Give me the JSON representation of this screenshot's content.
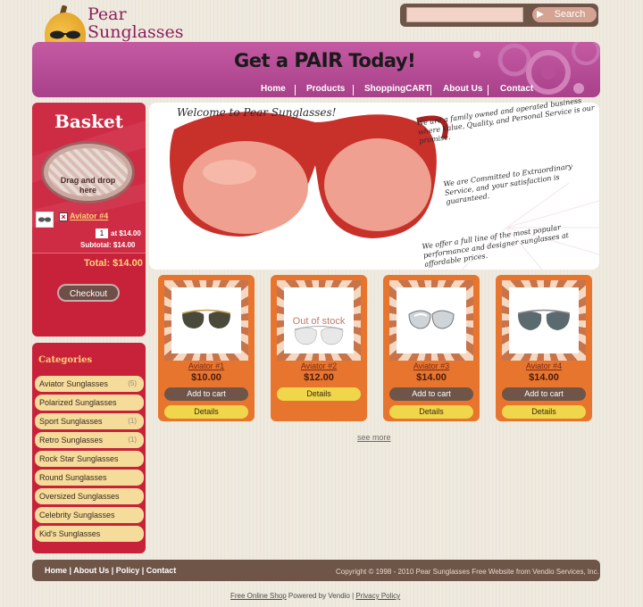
{
  "header": {
    "logo_line1": "Pear",
    "logo_line2": "Sunglasses",
    "search_placeholder": "",
    "search_button": "Search"
  },
  "banner": {
    "slogan_pre": "Get a",
    "slogan_big": "PAIR",
    "slogan_post": "Today!",
    "nav": [
      "Home",
      "Products",
      "ShoppingCART",
      "About Us",
      "Contact"
    ]
  },
  "basket": {
    "title": "Basket",
    "drop_text": "Drag and drop here",
    "item_name": "Aviator #4",
    "item_qty": "1",
    "item_price": "at $14.00",
    "subtotal": "Subtotal: $14.00",
    "total": "Total: $14.00",
    "checkout": "Checkout"
  },
  "categories": {
    "title": "Categories",
    "items": [
      {
        "label": "Aviator Sunglasses",
        "count": "(5)"
      },
      {
        "label": "Polarized Sunglasses",
        "count": ""
      },
      {
        "label": "Sport Sunglasses",
        "count": "(1)"
      },
      {
        "label": "Retro Sunglasses",
        "count": "(1)"
      },
      {
        "label": "Rock Star Sunglasses",
        "count": ""
      },
      {
        "label": "Round Sunglasses",
        "count": ""
      },
      {
        "label": "Oversized Sunglasses",
        "count": ""
      },
      {
        "label": "Celebrity Sunglasses",
        "count": ""
      },
      {
        "label": "Kid's Sunglasses",
        "count": ""
      }
    ]
  },
  "hero": {
    "welcome": "Welcome to Pear Sunglasses!",
    "note1": "We are a family owned and operated business where Value, Quality, and Personal Service is our promise.",
    "note2": "We are Committed to Extraordinary Service, and your satisfaction is guaranteed.",
    "note3": "We offer a full line of the most popular performance and designer sunglasses at affordable prices."
  },
  "products": [
    {
      "name": "Aviator #1",
      "price": "$10.00",
      "cart": "Add to cart",
      "details": "Details",
      "out_of_stock": ""
    },
    {
      "name": "Aviator #2",
      "price": "$12.00",
      "cart": "",
      "details": "Details",
      "out_of_stock": "Out of stock"
    },
    {
      "name": "Aviator #3",
      "price": "$14.00",
      "cart": "Add to cart",
      "details": "Details",
      "out_of_stock": ""
    },
    {
      "name": "Aviator #4",
      "price": "$14.00",
      "cart": "Add to cart",
      "details": "Details",
      "out_of_stock": ""
    }
  ],
  "see_more": "see more",
  "footer": {
    "links": [
      "Home",
      "About Us",
      "Policy",
      "Contact"
    ],
    "copyright": "Copyright © 1998 - 2010 Pear Sunglasses Free Website from Vendio Services, Inc.",
    "bottom_link1": "Free Online Shop",
    "bottom_mid": " Powered by Vendio | ",
    "bottom_link2": "Privacy Policy"
  }
}
